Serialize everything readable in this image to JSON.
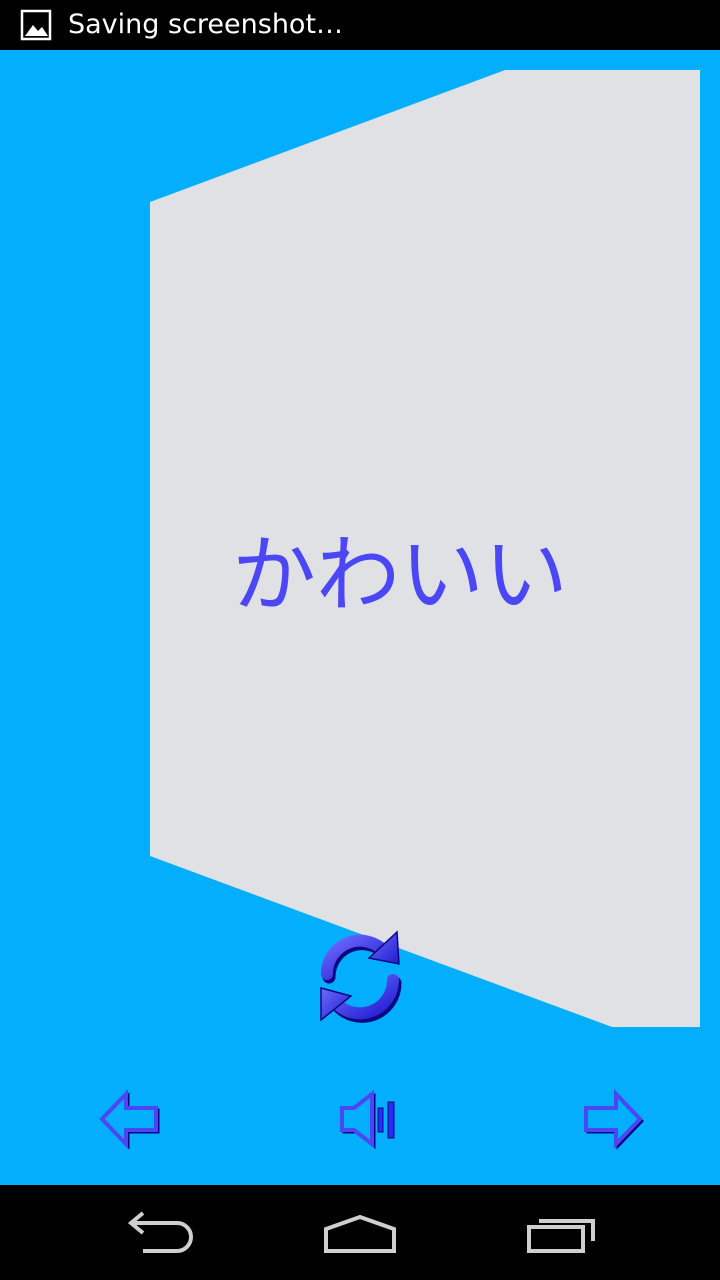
{
  "status_bar": {
    "notification_icon": "image-icon",
    "text": "Saving screenshot…"
  },
  "card": {
    "word": "かわいい",
    "colors": {
      "background": "#03AEFD",
      "card": "#E0E1E5",
      "word": "#4B47F4"
    }
  },
  "controls": {
    "flip_icon": "refresh-icon",
    "previous_icon": "arrow-left-icon",
    "sound_icon": "speaker-icon",
    "next_icon": "arrow-right-icon"
  },
  "nav_bar": {
    "back_icon": "back-icon",
    "home_icon": "home-icon",
    "recents_icon": "recents-icon"
  }
}
